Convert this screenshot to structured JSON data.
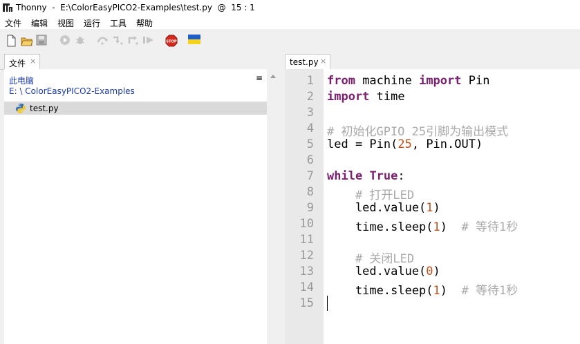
{
  "window": {
    "title": "Thonny  -  E:\\ColorEasyPICO2-Examples\\test.py  @  15 : 1"
  },
  "menu": {
    "items": [
      "文件",
      "编辑",
      "视图",
      "运行",
      "工具",
      "帮助"
    ]
  },
  "toolbar": {
    "icons": [
      "new-file-icon",
      "open-file-icon",
      "save-icon",
      "run-icon",
      "debug-icon",
      "step-over-icon",
      "step-into-icon",
      "step-out-icon",
      "resume-icon",
      "stop-icon",
      "ukraine-flag-icon"
    ],
    "stop_label": "STOP"
  },
  "files_panel": {
    "tab_label": "文件",
    "close_glyph": "×",
    "location_line1": "此电脑",
    "location_line2": "E: \\ ColorEasyPICO2-Examples",
    "menu_glyph": "≡",
    "files": [
      {
        "name": "test.py",
        "icon": "python-file-icon"
      }
    ]
  },
  "editor": {
    "tab_label": "test.py",
    "close_glyph": "×",
    "line_numbers": [
      "1",
      "2",
      "3",
      "4",
      "5",
      "6",
      "7",
      "8",
      "9",
      "10",
      "11",
      "12",
      "13",
      "14",
      "15"
    ],
    "lines": [
      [
        {
          "t": "from",
          "c": "kw"
        },
        {
          "t": " machine ",
          "c": ""
        },
        {
          "t": "import",
          "c": "kw"
        },
        {
          "t": " Pin",
          "c": ""
        }
      ],
      [
        {
          "t": "import",
          "c": "kw"
        },
        {
          "t": " time",
          "c": ""
        }
      ],
      [],
      [
        {
          "t": "# 初始化GPIO 25引脚为输出模式",
          "c": "cm"
        }
      ],
      [
        {
          "t": "led = Pin(",
          "c": ""
        },
        {
          "t": "25",
          "c": "num"
        },
        {
          "t": ", Pin.OUT)",
          "c": ""
        }
      ],
      [],
      [
        {
          "t": "while",
          "c": "kw"
        },
        {
          "t": " ",
          "c": ""
        },
        {
          "t": "True",
          "c": "kw"
        },
        {
          "t": ":",
          "c": ""
        }
      ],
      [
        {
          "t": "    ",
          "c": ""
        },
        {
          "t": "# 打开LED",
          "c": "cm"
        }
      ],
      [
        {
          "t": "    led.value(",
          "c": ""
        },
        {
          "t": "1",
          "c": "num"
        },
        {
          "t": ")",
          "c": ""
        }
      ],
      [
        {
          "t": "    time.sleep(",
          "c": ""
        },
        {
          "t": "1",
          "c": "num"
        },
        {
          "t": ")  ",
          "c": ""
        },
        {
          "t": "# 等待1秒",
          "c": "cm"
        }
      ],
      [],
      [
        {
          "t": "    ",
          "c": ""
        },
        {
          "t": "# 关闭LED",
          "c": "cm"
        }
      ],
      [
        {
          "t": "    led.value(",
          "c": ""
        },
        {
          "t": "0",
          "c": "num"
        },
        {
          "t": ")",
          "c": ""
        }
      ],
      [
        {
          "t": "    time.sleep(",
          "c": ""
        },
        {
          "t": "1",
          "c": "num"
        },
        {
          "t": ")  ",
          "c": ""
        },
        {
          "t": "# 等待1秒",
          "c": "cm"
        }
      ],
      []
    ]
  },
  "colors": {
    "keyword": "#7a1f6e",
    "number": "#c0511a",
    "comment": "#a9a9a9",
    "path_link": "#1a3aa8"
  }
}
